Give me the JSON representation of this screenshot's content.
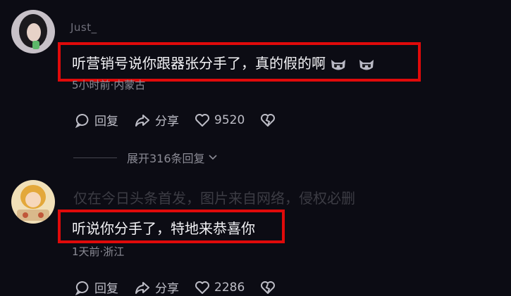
{
  "comments": [
    {
      "username": "Just_",
      "text": "听营销号说你跟器张分手了，真的假的啊",
      "emojis": [
        "cat-face-emoji",
        "cat-face-emoji"
      ],
      "meta": "5小时前·内蒙古",
      "actions": {
        "reply": "回复",
        "share": "分享",
        "likes": "9520"
      },
      "expand_label": "展开316条回复"
    },
    {
      "watermark": "仅在今日头条首发，图片来自网络，侵权必删",
      "text": "听说你分手了，特地来恭喜你",
      "meta": "1天前·浙江",
      "actions": {
        "reply": "回复",
        "share": "分享",
        "likes": "2286"
      }
    }
  ],
  "colors": {
    "highlight_box": "#e00a0a",
    "background": "#0c0c14"
  }
}
